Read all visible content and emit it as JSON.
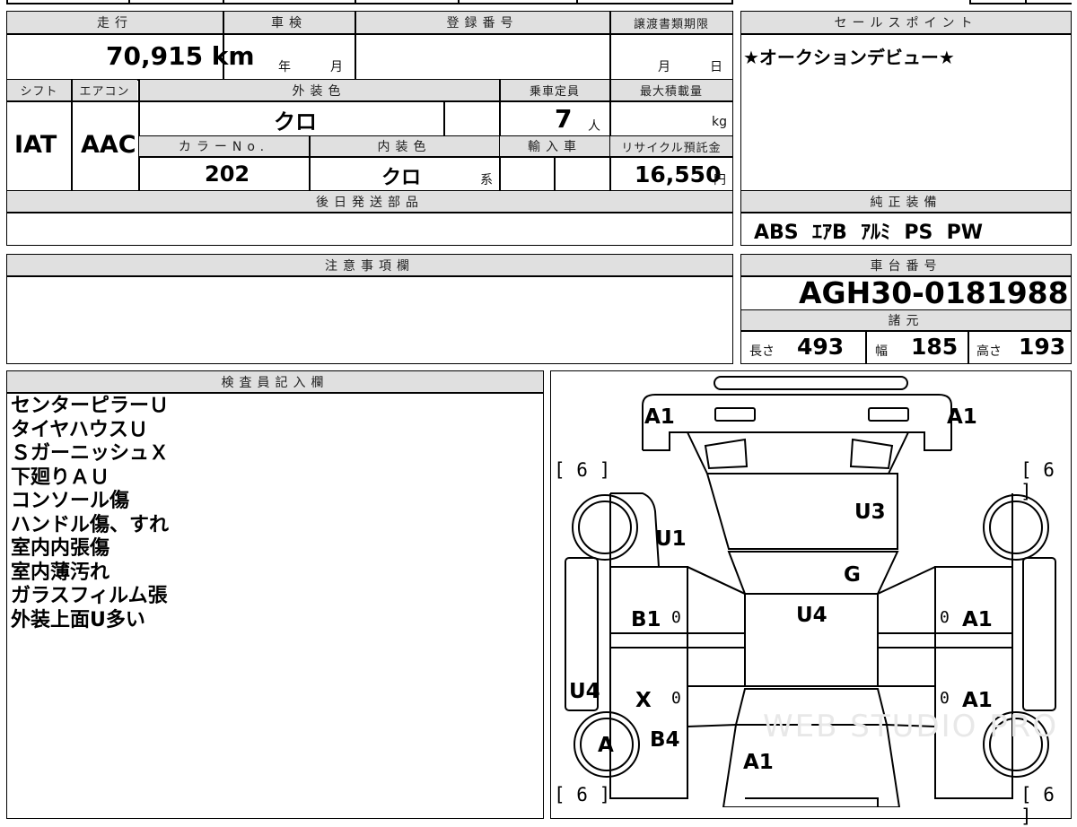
{
  "vehicle": {
    "mileage_label": "走行",
    "mileage": "70,915 km",
    "shaken_label": "車検",
    "shaken_year_unit": "年",
    "shaken_month_unit": "月",
    "reg_number_label": "登録番号",
    "transfer_deadline_label": "譲渡書類期限",
    "transfer_month_unit": "月",
    "transfer_day_unit": "日",
    "shift_label": "シフト",
    "shift": "IAT",
    "aircon_label": "エアコン",
    "aircon": "AAC",
    "exterior_color_label": "外装色",
    "exterior_color": "クロ",
    "capacity_label": "乗車定員",
    "capacity": "7",
    "capacity_unit": "人",
    "max_load_label": "最大積載量",
    "max_load_unit": "kg",
    "color_no_label": "カラーNo.",
    "color_no": "202",
    "interior_color_label": "内装色",
    "interior_color": "クロ",
    "interior_color_suffix": "系",
    "import_label": "輸入車",
    "recycle_label": "リサイクル預託金",
    "recycle_fee": "16,550",
    "recycle_unit": "円",
    "later_parts_label": "後日発送部品"
  },
  "sales_point": {
    "label": "セールスポイント",
    "text": "★オークションデビュー★"
  },
  "genuine_equipment": {
    "label": "純正装備",
    "items": "ABS  ｴｱB  ｱﾙﾐ  PS  PW"
  },
  "notes_section": {
    "label": "注意事項欄"
  },
  "chassis": {
    "label": "車台番号",
    "number": "AGH30-0181988"
  },
  "specs": {
    "label": "諸元",
    "length_label": "長さ",
    "length": "493",
    "width_label": "幅",
    "width": "185",
    "height_label": "高さ",
    "height": "193"
  },
  "inspector": {
    "label": "検査員記入欄",
    "lines": [
      "センターピラーＵ",
      "タイヤハウスＵ",
      "ＳガーニッシュＸ",
      "下廻りＡＵ",
      "コンソール傷",
      "ハンドル傷、すれ",
      "室内内張傷",
      "室内薄汚れ",
      "ガラスフィルム張",
      "外装上面U多い"
    ]
  },
  "diagram": {
    "marks": {
      "front_left": "A1",
      "front_right": "A1",
      "hood": "U3",
      "left_fender": "U1",
      "windshield": "G",
      "roof": "U4",
      "left_front_door": "B1",
      "right_front_door": "A1",
      "left_sill": "U4",
      "left_rear_door": "X",
      "right_rear_door": "A1",
      "rear_left_wheel": "A",
      "left_quarter": "B4",
      "back_door": "A1"
    },
    "tire_labels": [
      "[ 6 ]",
      "[ 6 ]",
      "[ 6 ]",
      "[ 6 ]"
    ],
    "window_marks": [
      "0",
      "0",
      "0",
      "0"
    ],
    "watermark": "WEB STUDIO PRO"
  }
}
